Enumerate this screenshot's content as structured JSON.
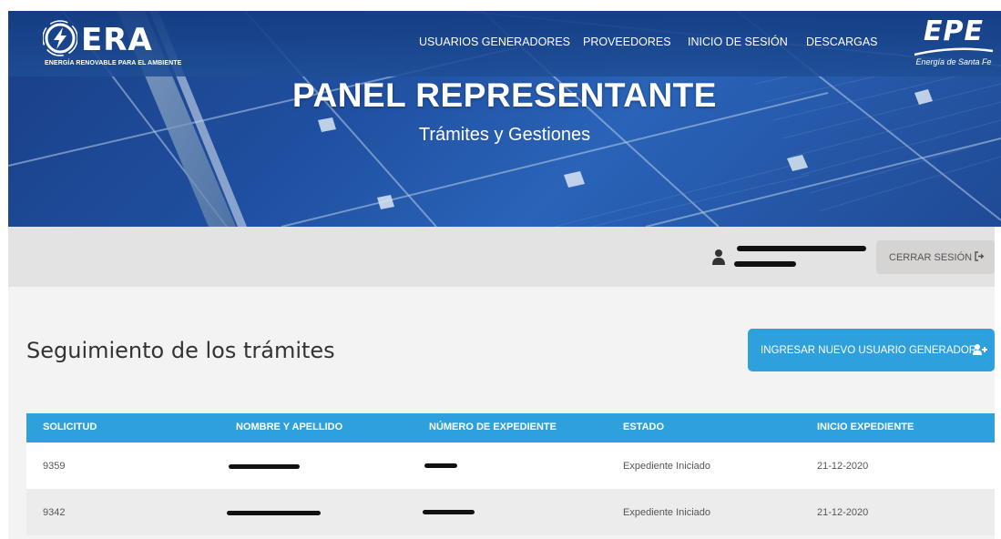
{
  "brand": {
    "left_logo": "ERA",
    "left_tagline": "ENERGÍA RENOVABLE PARA EL AMBIENTE",
    "right_logo": "EPE",
    "right_tagline": "Energía de Santa Fe"
  },
  "nav": {
    "items": [
      {
        "label": "USUARIOS GENERADORES"
      },
      {
        "label": "PROVEEDORES"
      },
      {
        "label": "INICIO DE SESIÓN"
      },
      {
        "label": "DESCARGAS"
      }
    ]
  },
  "hero": {
    "title": "PANEL REPRESENTANTE",
    "subtitle": "Trámites y Gestiones"
  },
  "userbar": {
    "user_icon": "user-icon",
    "logout_label": "CERRAR SESIÓN",
    "logout_icon": "sign-out-icon"
  },
  "main": {
    "title": "Seguimiento de los trámites",
    "add_button_label": "INGRESAR NUEVO USUARIO GENERADOR",
    "add_button_icon": "user-plus-icon",
    "table": {
      "headers": [
        "SOLICITUD",
        "NOMBRE Y APELLIDO",
        "NÚMERO DE EXPEDIENTE",
        "ESTADO",
        "INICIO EXPEDIENTE"
      ],
      "rows": [
        {
          "solicitud": "9359",
          "estado": "Expediente Iniciado",
          "inicio": "21-12-2020"
        },
        {
          "solicitud": "9342",
          "estado": "Expediente Iniciado",
          "inicio": "21-12-2020"
        }
      ]
    }
  },
  "colors": {
    "accent": "#2ea1dd",
    "hero_blue": "#1f4fa0",
    "userbar_bg": "#e3e3e3",
    "content_bg": "#f3f3f3"
  }
}
